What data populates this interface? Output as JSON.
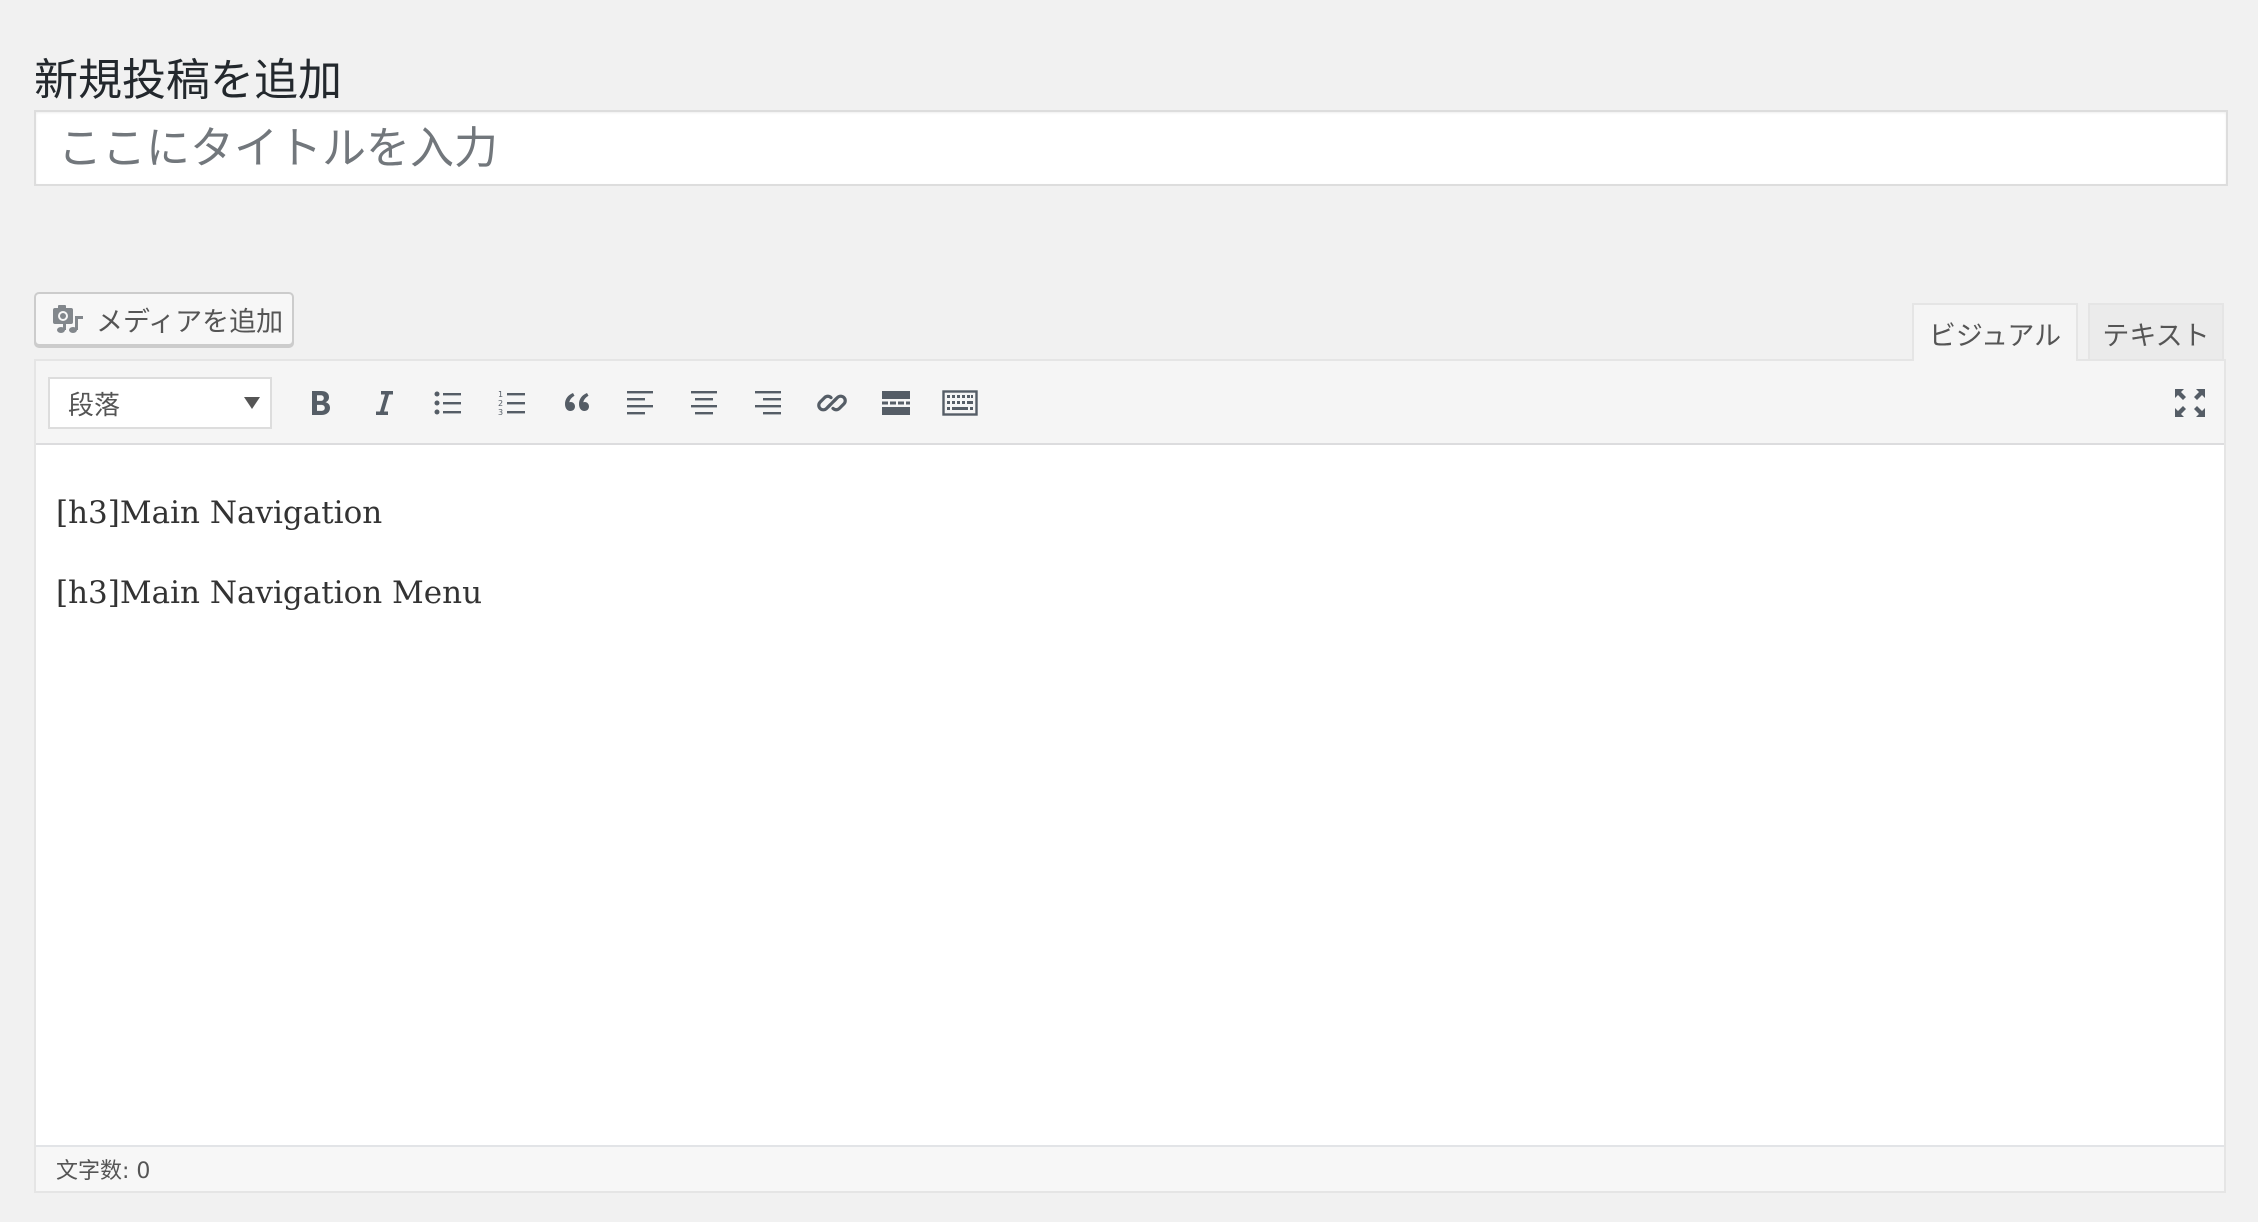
{
  "page": {
    "heading": "新規投稿を追加"
  },
  "title_field": {
    "placeholder": "ここにタイトルを入力",
    "value": ""
  },
  "media": {
    "label": "メディアを追加",
    "icon": "media-camera-music-icon"
  },
  "tabs": [
    {
      "label": "ビジュアル",
      "active": true
    },
    {
      "label": "テキスト",
      "active": false
    }
  ],
  "toolbar": {
    "format_selected": "段落",
    "buttons": [
      {
        "name": "bold",
        "icon": "bold-icon"
      },
      {
        "name": "italic",
        "icon": "italic-icon"
      },
      {
        "name": "bulleted-list",
        "icon": "bulleted-list-icon"
      },
      {
        "name": "numbered-list",
        "icon": "numbered-list-icon"
      },
      {
        "name": "blockquote",
        "icon": "blockquote-icon"
      },
      {
        "name": "align-left",
        "icon": "align-left-icon"
      },
      {
        "name": "align-center",
        "icon": "align-center-icon"
      },
      {
        "name": "align-right",
        "icon": "align-right-icon"
      },
      {
        "name": "insert-link",
        "icon": "link-icon"
      },
      {
        "name": "read-more",
        "icon": "read-more-icon"
      },
      {
        "name": "toolbar-toggle",
        "icon": "keyboard-icon"
      },
      {
        "name": "distraction-free",
        "icon": "fullscreen-icon"
      }
    ]
  },
  "content": {
    "paragraphs": [
      "[h3]Main Navigation",
      "[h3]Main Navigation Menu"
    ]
  },
  "status": {
    "word_count": "文字数: 0"
  },
  "colors": {
    "background": "#f1f1f1",
    "panel": "#ffffff",
    "toolbar": "#f5f5f5",
    "border": "#dddddd",
    "text": "#23282d",
    "icon": "#555d66"
  }
}
